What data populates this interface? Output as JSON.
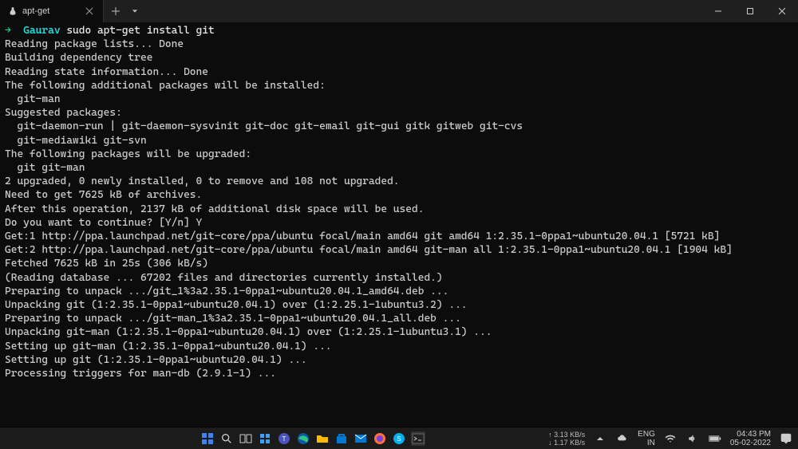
{
  "window": {
    "tab_title": "apt-get",
    "new_tab_tooltip": "New tab"
  },
  "prompt": {
    "arrow": "→",
    "user": "Gaurav",
    "command": "sudo apt-get install git"
  },
  "output_lines": [
    "Reading package lists... Done",
    "Building dependency tree",
    "Reading state information... Done",
    "The following additional packages will be installed:",
    "  git-man",
    "Suggested packages:",
    "  git-daemon-run | git-daemon-sysvinit git-doc git-email git-gui gitk gitweb git-cvs",
    "  git-mediawiki git-svn",
    "The following packages will be upgraded:",
    "  git git-man",
    "2 upgraded, 0 newly installed, 0 to remove and 108 not upgraded.",
    "Need to get 7625 kB of archives.",
    "After this operation, 2137 kB of additional disk space will be used.",
    "Do you want to continue? [Y/n] Y",
    "Get:1 http://ppa.launchpad.net/git-core/ppa/ubuntu focal/main amd64 git amd64 1:2.35.1-0ppa1~ubuntu20.04.1 [5721 kB]",
    "Get:2 http://ppa.launchpad.net/git-core/ppa/ubuntu focal/main amd64 git-man all 1:2.35.1-0ppa1~ubuntu20.04.1 [1904 kB]",
    "Fetched 7625 kB in 25s (306 kB/s)",
    "(Reading database ... 67202 files and directories currently installed.)",
    "Preparing to unpack .../git_1%3a2.35.1-0ppa1~ubuntu20.04.1_amd64.deb ...",
    "Unpacking git (1:2.35.1-0ppa1~ubuntu20.04.1) over (1:2.25.1-1ubuntu3.2) ...",
    "Preparing to unpack .../git-man_1%3a2.35.1-0ppa1~ubuntu20.04.1_all.deb ...",
    "Unpacking git-man (1:2.35.1-0ppa1~ubuntu20.04.1) over (1:2.25.1-1ubuntu3.1) ...",
    "Setting up git-man (1:2.35.1-0ppa1~ubuntu20.04.1) ...",
    "Setting up git (1:2.35.1-0ppa1~ubuntu20.04.1) ...",
    "Processing triggers for man-db (2.9.1-1) ..."
  ],
  "taskbar": {
    "net_up": "↑ 3.13 KB/s",
    "net_down": "↓ 1.17 KB/s",
    "lang_top": "ENG",
    "lang_bottom": "IN",
    "time": "04:43 PM",
    "date": "05-02-2022"
  }
}
